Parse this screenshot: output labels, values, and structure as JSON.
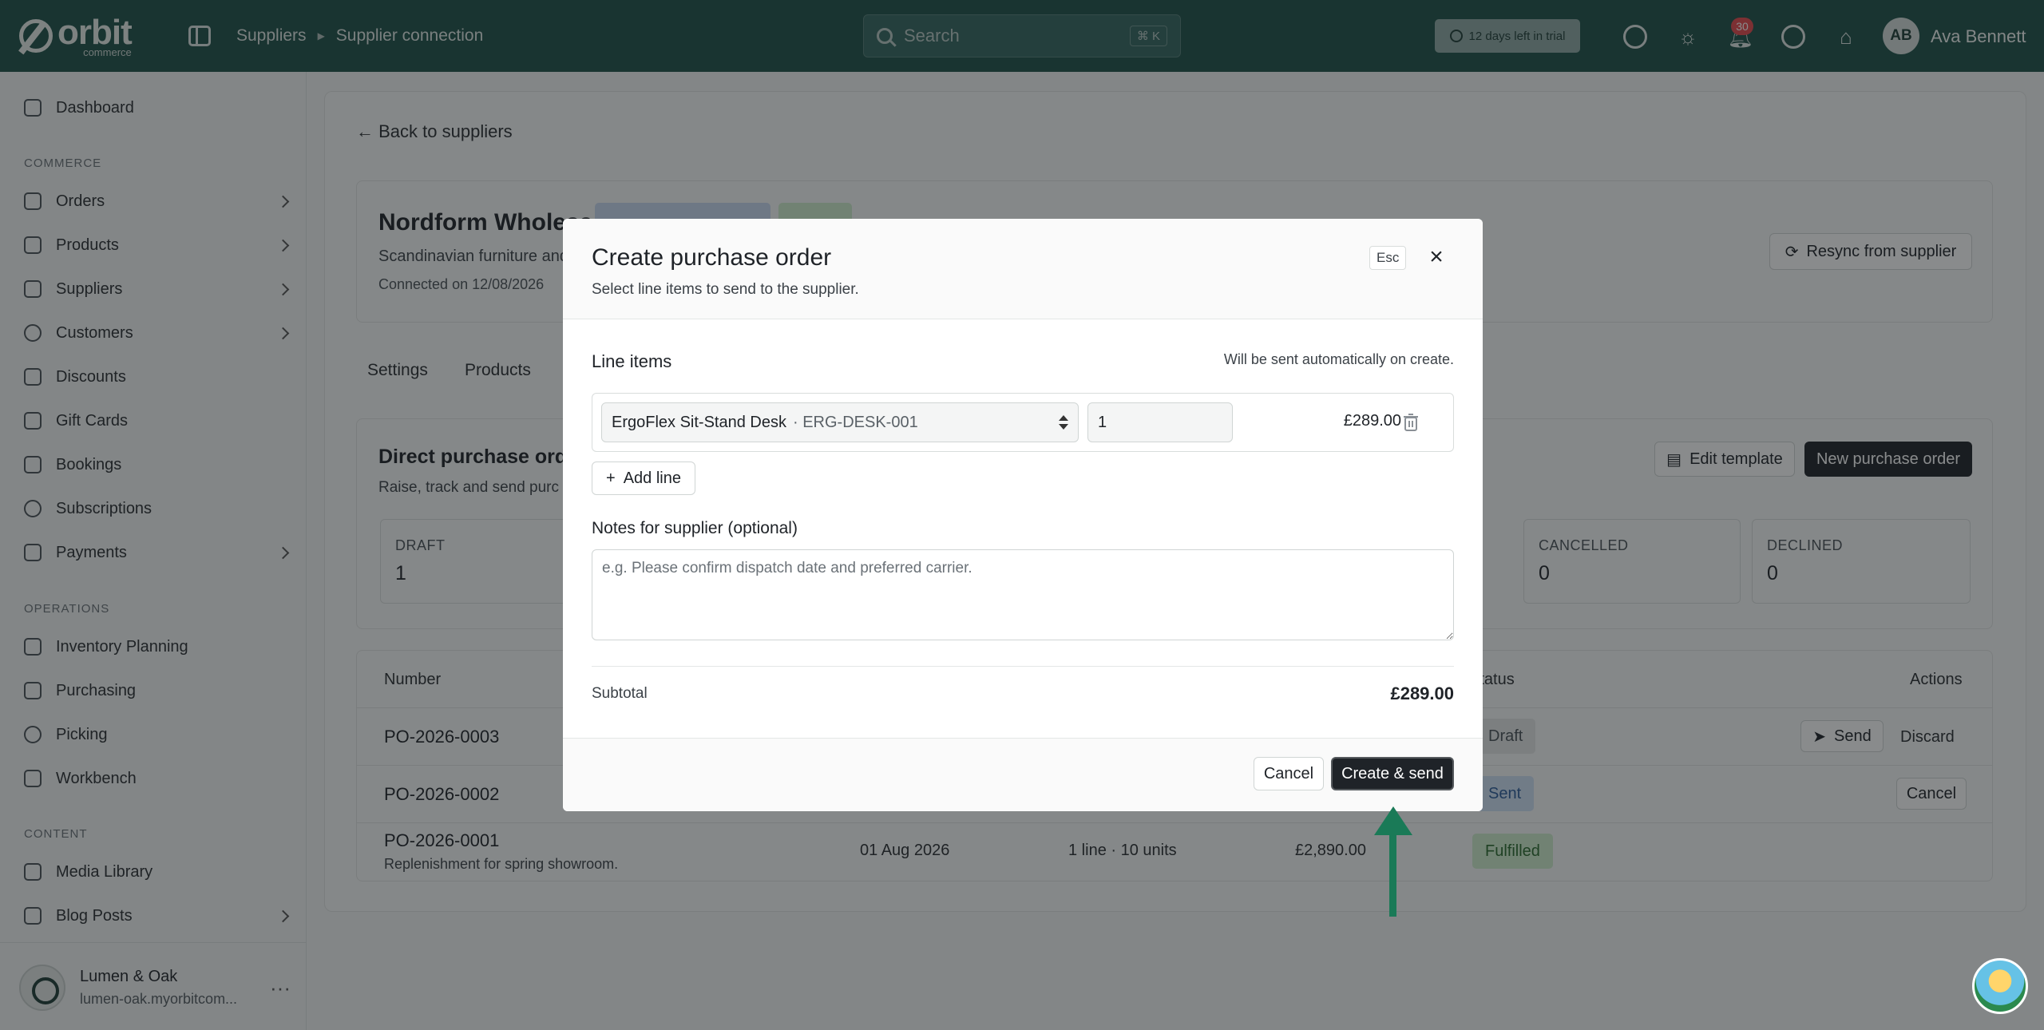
{
  "app": {
    "logo_word": "orbit",
    "logo_sub": "commerce"
  },
  "header": {
    "breadcrumbs": [
      "Suppliers",
      "Supplier connection"
    ],
    "search_placeholder": "Search",
    "search_shortcut": "⌘ K",
    "trial_text": "12 days left in trial",
    "notification_count": "30",
    "user_initials": "AB",
    "user_name": "Ava Bennett"
  },
  "sidebar": {
    "dashboard": "Dashboard",
    "section_commerce": "COMMERCE",
    "commerce_items": [
      "Orders",
      "Products",
      "Suppliers",
      "Customers",
      "Discounts",
      "Gift Cards",
      "Bookings",
      "Subscriptions",
      "Payments"
    ],
    "section_operations": "OPERATIONS",
    "operations_items": [
      "Inventory Planning",
      "Purchasing",
      "Picking",
      "Workbench"
    ],
    "section_content": "CONTENT",
    "content_items": [
      "Media Library",
      "Blog Posts"
    ],
    "store_name": "Lumen & Oak",
    "store_url": "lumen-oak.myorbitcom..."
  },
  "page": {
    "back_label": "Back to suppliers",
    "supplier_name": "Nordform Wholesa",
    "supplier_desc": "Scandinavian furniture and",
    "connected_on": "Connected on 12/08/2026",
    "resync_label": "Resync from supplier",
    "tabs": [
      "Settings",
      "Products"
    ],
    "po_section_title": "Direct purchase orde",
    "po_section_desc": "Raise, track and send purc",
    "edit_template_label": "Edit template",
    "new_po_label": "New purchase order",
    "stats": [
      {
        "label": "DRAFT",
        "value": "1"
      },
      {
        "label": "CANCELLED",
        "value": "0"
      },
      {
        "label": "DECLINED",
        "value": "0"
      }
    ],
    "table_headers": {
      "number": "Number",
      "status": "Status",
      "actions": "Actions"
    },
    "rows": [
      {
        "number": "PO-2026-0003",
        "status": "Draft",
        "actions": [
          "Send",
          "Discard"
        ]
      },
      {
        "number": "PO-2026-0002",
        "status": "Sent",
        "actions": [
          "Cancel"
        ]
      },
      {
        "number": "PO-2026-0001",
        "sub": "Replenishment for spring showroom.",
        "date": "01 Aug 2026",
        "lines": "1 line · 10 units",
        "total": "£2,890.00",
        "status": "Fulfilled"
      }
    ]
  },
  "modal": {
    "title": "Create purchase order",
    "subtitle": "Select line items to send to the supplier.",
    "esc_label": "Esc",
    "line_items_label": "Line items",
    "line_items_note": "Will be sent automatically on create.",
    "product_name": "ErgoFlex Sit-Stand Desk",
    "product_sku": "· ERG-DESK-001",
    "quantity": "1",
    "line_price": "£289.00",
    "add_line_label": "Add line",
    "notes_label": "Notes for supplier (optional)",
    "notes_placeholder": "e.g. Please confirm dispatch date and preferred carrier.",
    "subtotal_label": "Subtotal",
    "subtotal_value": "£289.00",
    "cancel_label": "Cancel",
    "create_label": "Create & send"
  },
  "colors": {
    "topbar": "#1f5148",
    "primary_button": "#1f2328",
    "annotation_arrow": "#1a7a57",
    "status_draft": "#e4e7e6",
    "status_sent": "#cfe0f5",
    "status_fulfilled": "#cfeccd"
  }
}
